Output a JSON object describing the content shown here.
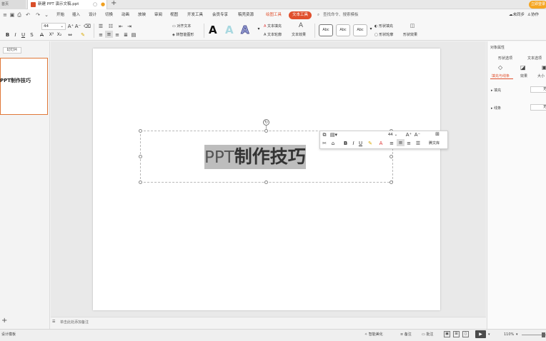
{
  "titlebar": {
    "home_tab": "首页",
    "doc_tab": "新建 PPT 演示文稿.ppt",
    "promo": "立即登录"
  },
  "menu": {
    "items": [
      "开始",
      "插入",
      "设计",
      "切换",
      "动画",
      "放映",
      "审阅",
      "视图",
      "开发工具",
      "会员专享",
      "稿壳资源"
    ],
    "drawing_tools": "绘图工具",
    "text_tools": "文本工具",
    "search_placeholder": "查找命令、搜索模板",
    "sync": "未同步",
    "collab": "协作"
  },
  "ribbon": {
    "font_size": "44",
    "align_text": "对齐文本",
    "smart_shape": "转智能图形",
    "text_fill": "文本填充",
    "text_outline": "文本轮廓",
    "text_effect": "文本效果",
    "shape_fill": "形状填充",
    "shape_outline": "形状轮廓",
    "shape_effect": "形状效果",
    "style_sample": "Abc",
    "styles": [
      "Abc",
      "Abc",
      "Abc"
    ]
  },
  "left_panel": {
    "tab": "幻灯片",
    "thumb_text": "PPT制作技巧"
  },
  "slide": {
    "text_normal": "PPT",
    "text_bold": "制作技巧"
  },
  "mini_toolbar": {
    "font_size": "44",
    "text_lib": "腾文库"
  },
  "right_panel": {
    "title": "对象属性",
    "tab_shape": "形状选项",
    "tab_text": "文本选项",
    "sub_fill_line": "填充与线条",
    "sub_effect": "效果",
    "sub_size": "大小",
    "fill": "填充",
    "line": "线条",
    "fill_value": "无",
    "line_value": "无"
  },
  "notes": {
    "placeholder": "单击此处添加备注"
  },
  "status": {
    "design": "设计模板",
    "smart_beautify": "智能美化",
    "notes": "备注",
    "comments": "批注",
    "zoom": "110%"
  },
  "colors": {
    "accent": "#e0502d",
    "thumb_border": "#e07838",
    "promo": "#f5a623"
  }
}
